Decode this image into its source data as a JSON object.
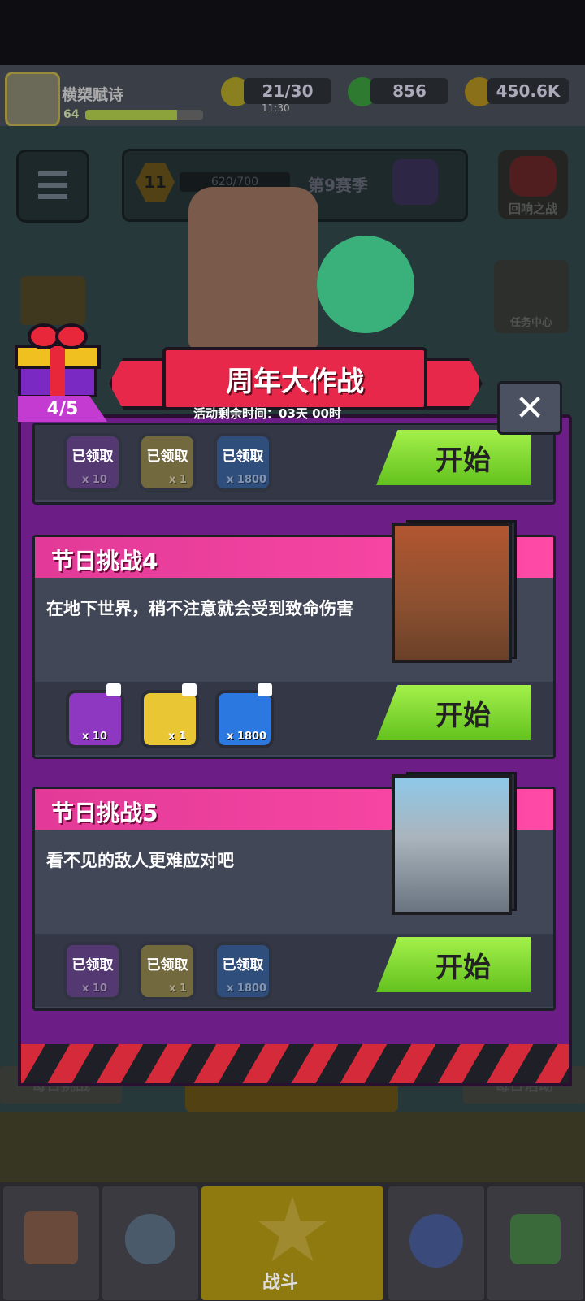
{
  "hud": {
    "player_name": "横槊赋诗",
    "player_level": "64",
    "xp_fraction": 0.78,
    "energy": "21/30",
    "energy_timer": "11:30",
    "gems": "856",
    "gold": "450.6K"
  },
  "season": {
    "tier": "11",
    "progress": "620/700",
    "label": "第9赛季"
  },
  "right_menu": {
    "echo_battle": "回响之战",
    "task_center": "任务中心"
  },
  "bottom_plates": {
    "daily_challenge": "每日挑战",
    "daily_activity": "每日活动"
  },
  "bottom_nav": {
    "battle": "战斗"
  },
  "event": {
    "title": "周年大作战",
    "timer": "活动剩余时间：03天 00时",
    "progress": "4/5",
    "close": "✕",
    "start_label": "开始",
    "claimed_label": "已领取",
    "rewards": [
      "x 10",
      "x 1",
      "x 1800"
    ],
    "challenges": [
      {
        "title": "节日挑战4",
        "desc": "在地下世界，稍不注意就会受到致命伤害"
      },
      {
        "title": "节日挑战5",
        "desc": "看不见的敌人更难应对吧"
      }
    ]
  },
  "colors": {
    "modal": "#6d1e86",
    "header_pink": "#ff4aa6",
    "start_green": "#7fd52c",
    "banner_red": "#e8284a"
  }
}
